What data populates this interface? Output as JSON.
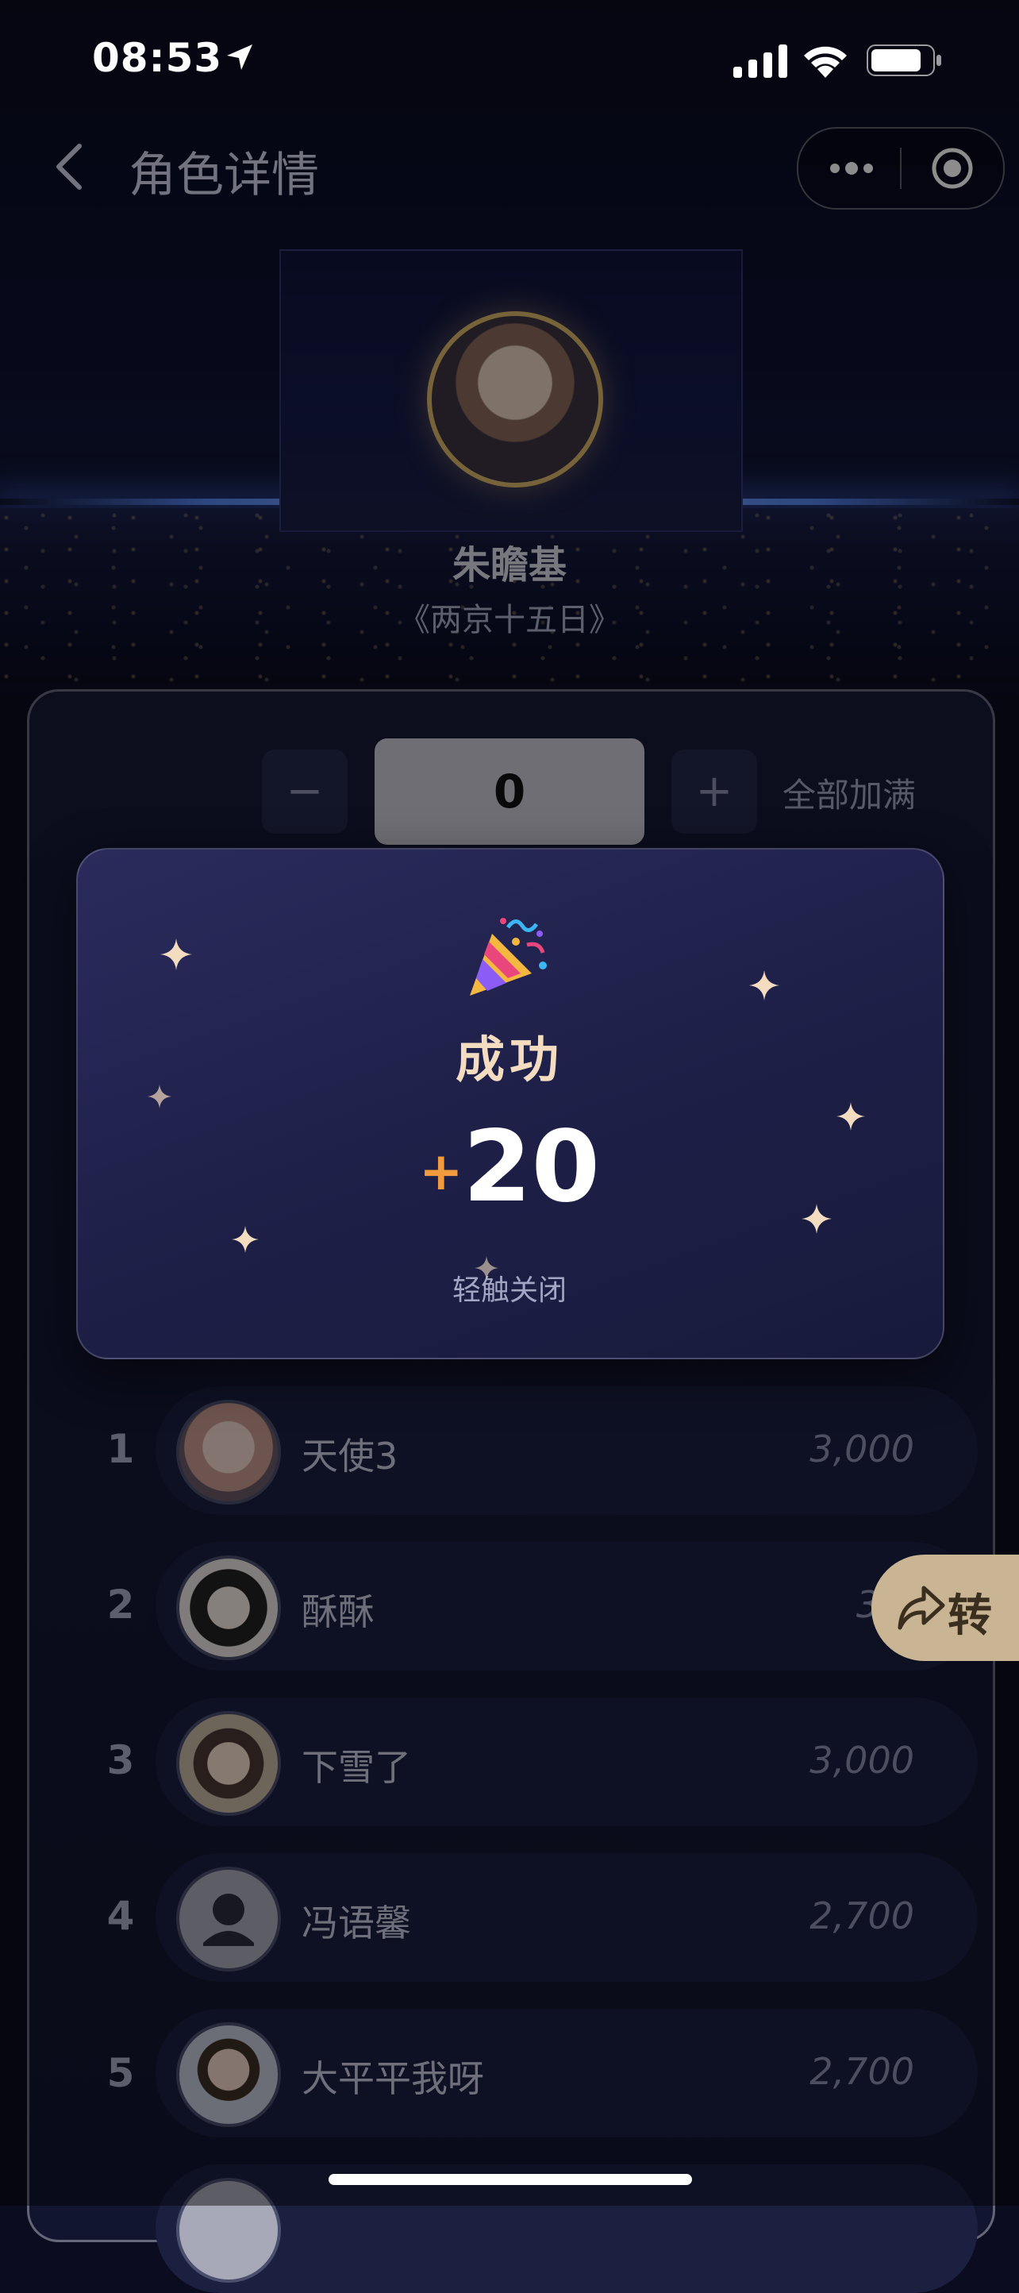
{
  "status_bar": {
    "time": "08:53"
  },
  "nav": {
    "title": "角色详情"
  },
  "role": {
    "name": "朱瞻基",
    "work": "《两京十五日》"
  },
  "stepper": {
    "minus": "−",
    "value": "0",
    "plus": "+",
    "fill_all": "全部加满"
  },
  "modal": {
    "title": "成功",
    "plus_sign": "+",
    "amount": "20",
    "tap_close": "轻触关闭"
  },
  "ranking": [
    {
      "rank": "1",
      "name": "天使3",
      "score": "3,000"
    },
    {
      "rank": "2",
      "name": "酥酥",
      "score": "3,0"
    },
    {
      "rank": "3",
      "name": "下雪了",
      "score": "3,000"
    },
    {
      "rank": "4",
      "name": "冯语馨",
      "score": "2,700"
    },
    {
      "rank": "5",
      "name": "大平平我呀",
      "score": "2,700"
    }
  ],
  "share": {
    "label": "转"
  },
  "colors": {
    "accent": "#f29b3e",
    "modal_title": "#f3dcc0",
    "share_bg": "#c9b493"
  }
}
